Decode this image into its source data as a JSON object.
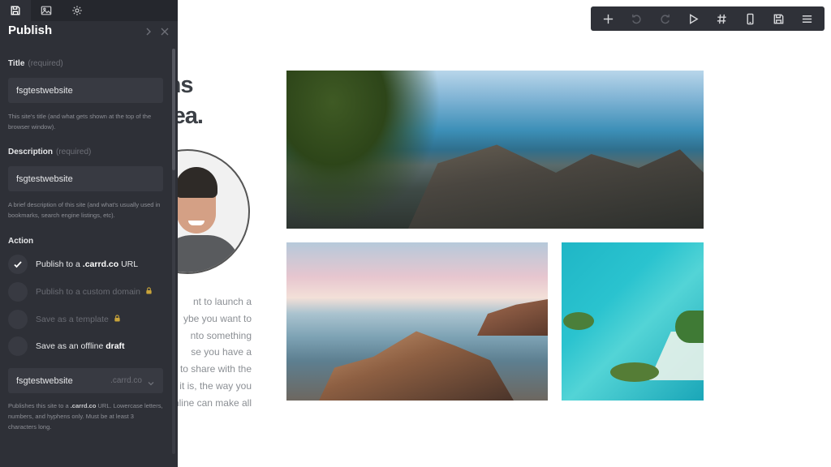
{
  "panel": {
    "tabs": [
      {
        "name": "save-icon",
        "active": true
      },
      {
        "name": "image-icon",
        "active": false
      },
      {
        "name": "gear-icon",
        "active": false
      }
    ],
    "title": "Publish",
    "title_field": {
      "label": "Title",
      "required": "(required)",
      "value": "fsgtestwebsite",
      "help": "This site's title (and what gets shown at the top of the browser window)."
    },
    "description_field": {
      "label": "Description",
      "required": "(required)",
      "value": "fsgtestwebsite",
      "help": "A brief description of this site (and what's usually used in bookmarks, search engine listings, etc)."
    },
    "action": {
      "label": "Action",
      "options": [
        {
          "pre": "Publish to a ",
          "bold": ".carrd.co",
          "post": " URL",
          "selected": true,
          "locked": false,
          "disabled": false
        },
        {
          "pre": "Publish to a custom domain",
          "bold": "",
          "post": "",
          "selected": false,
          "locked": true,
          "disabled": true
        },
        {
          "pre": "Save as a template",
          "bold": "",
          "post": "",
          "selected": false,
          "locked": true,
          "disabled": true
        },
        {
          "pre": "Save as an offline ",
          "bold": "draft",
          "post": "",
          "selected": false,
          "locked": false,
          "disabled": false
        }
      ]
    },
    "url": {
      "subdomain": "fsgtestwebsite",
      "domain": ".carrd.co",
      "help_pre": "Publishes this site to a ",
      "help_bold": ".carrd.co",
      "help_post": " URL. Lowercase letters, numbers, and hyphens only. Must be at least 3 characters long."
    }
  },
  "toolbar": {
    "buttons": [
      {
        "name": "add-icon",
        "enabled": true
      },
      {
        "name": "undo-icon",
        "enabled": false
      },
      {
        "name": "redo-icon",
        "enabled": false
      },
      {
        "name": "play-icon",
        "enabled": true
      },
      {
        "name": "hash-icon",
        "enabled": true
      },
      {
        "name": "phone-icon",
        "enabled": true
      },
      {
        "name": "save-icon",
        "enabled": true
      },
      {
        "name": "menu-icon",
        "enabled": true
      }
    ]
  },
  "site": {
    "headline": [
      "begins",
      "an idea."
    ],
    "paragraph": [
      "nt to launch a",
      "ybe you want to",
      "nto something",
      "se you have a",
      "st to share with the",
      "er it is, the way you",
      "online can make all"
    ],
    "social": [
      "twitter-icon",
      "mail-icon"
    ]
  }
}
